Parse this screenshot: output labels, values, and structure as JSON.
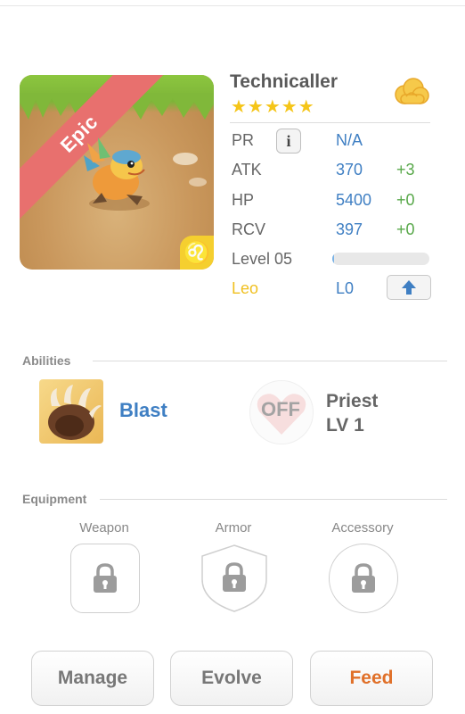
{
  "monster": {
    "name": "Technicaller",
    "stars": "★★★★★",
    "rarity": "Epic",
    "zodiac_glyph": "♌",
    "element_icon": "cloud-icon"
  },
  "stats": {
    "pr_label": "PR",
    "pr_info_glyph": "i",
    "pr_value": "N/A",
    "atk_label": "ATK",
    "atk_value": "370",
    "atk_bonus": "+3",
    "hp_label": "HP",
    "hp_value": "5400",
    "hp_bonus": "+0",
    "rcv_label": "RCV",
    "rcv_value": "397",
    "rcv_bonus": "+0",
    "level_label": "Level 05",
    "level_progress": 0.02,
    "zodiac_name": "Leo",
    "zodiac_level": "L0"
  },
  "abilities": {
    "section_title": "Abilities",
    "active_name": "Blast",
    "passive_state": "OFF",
    "passive_name": "Priest",
    "passive_level": "LV 1"
  },
  "equipment": {
    "section_title": "Equipment",
    "weapon_label": "Weapon",
    "armor_label": "Armor",
    "accessory_label": "Accessory"
  },
  "actions": {
    "manage": "Manage",
    "evolve": "Evolve",
    "feed": "Feed"
  },
  "colors": {
    "accent_blue": "#3f7fc3",
    "bonus_green": "#58a84a",
    "rarity_red": "#e8706e",
    "zodiac_yellow": "#f5cf2f",
    "feed_orange": "#e07029"
  }
}
